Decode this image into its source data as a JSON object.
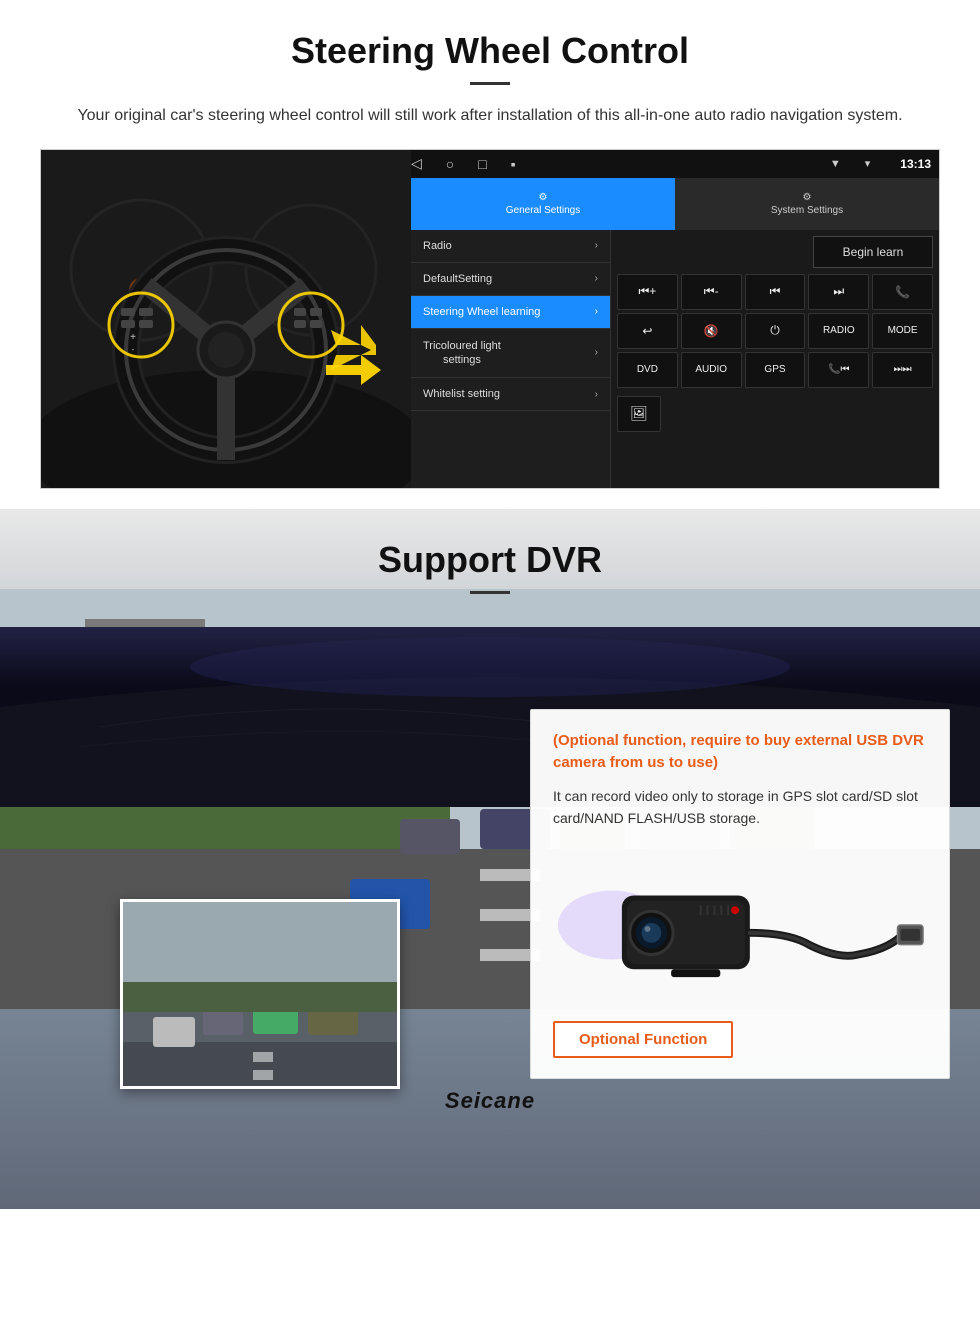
{
  "page": {
    "steering_section": {
      "title": "Steering Wheel Control",
      "description": "Your original car's steering wheel control will still work after installation of this all-in-one auto radio navigation system.",
      "status_bar": {
        "signal_icon": "▼",
        "wifi_icon": "▾",
        "time": "13:13"
      },
      "nav_bar": {
        "back": "◁",
        "home": "○",
        "recents": "□",
        "menu": "▪"
      },
      "tabs": {
        "general": {
          "label": "General Settings",
          "icon": "⚙"
        },
        "system": {
          "label": "System Settings",
          "icon": "🔧"
        }
      },
      "menu_items": [
        {
          "label": "Radio",
          "active": false
        },
        {
          "label": "DefaultSetting",
          "active": false
        },
        {
          "label": "Steering Wheel learning",
          "active": true
        },
        {
          "label": "Tricoloured light settings",
          "active": false
        },
        {
          "label": "Whitelist setting",
          "active": false
        }
      ],
      "begin_learn_label": "Begin learn",
      "control_buttons": [
        "⏮+",
        "⏮-",
        "⏮",
        "⏭",
        "📞",
        "↩",
        "🔇",
        "⏻",
        "RADIO",
        "MODE",
        "DVD",
        "AUDIO",
        "GPS",
        "📞⏮",
        "⏭⏭"
      ]
    },
    "dvr_section": {
      "title": "Support DVR",
      "optional_text": "(Optional function, require to buy external USB DVR camera from us to use)",
      "description": "It can record video only to storage in GPS slot card/SD slot card/NAND FLASH/USB storage.",
      "optional_function_label": "Optional Function",
      "brand": "Seicane"
    }
  }
}
